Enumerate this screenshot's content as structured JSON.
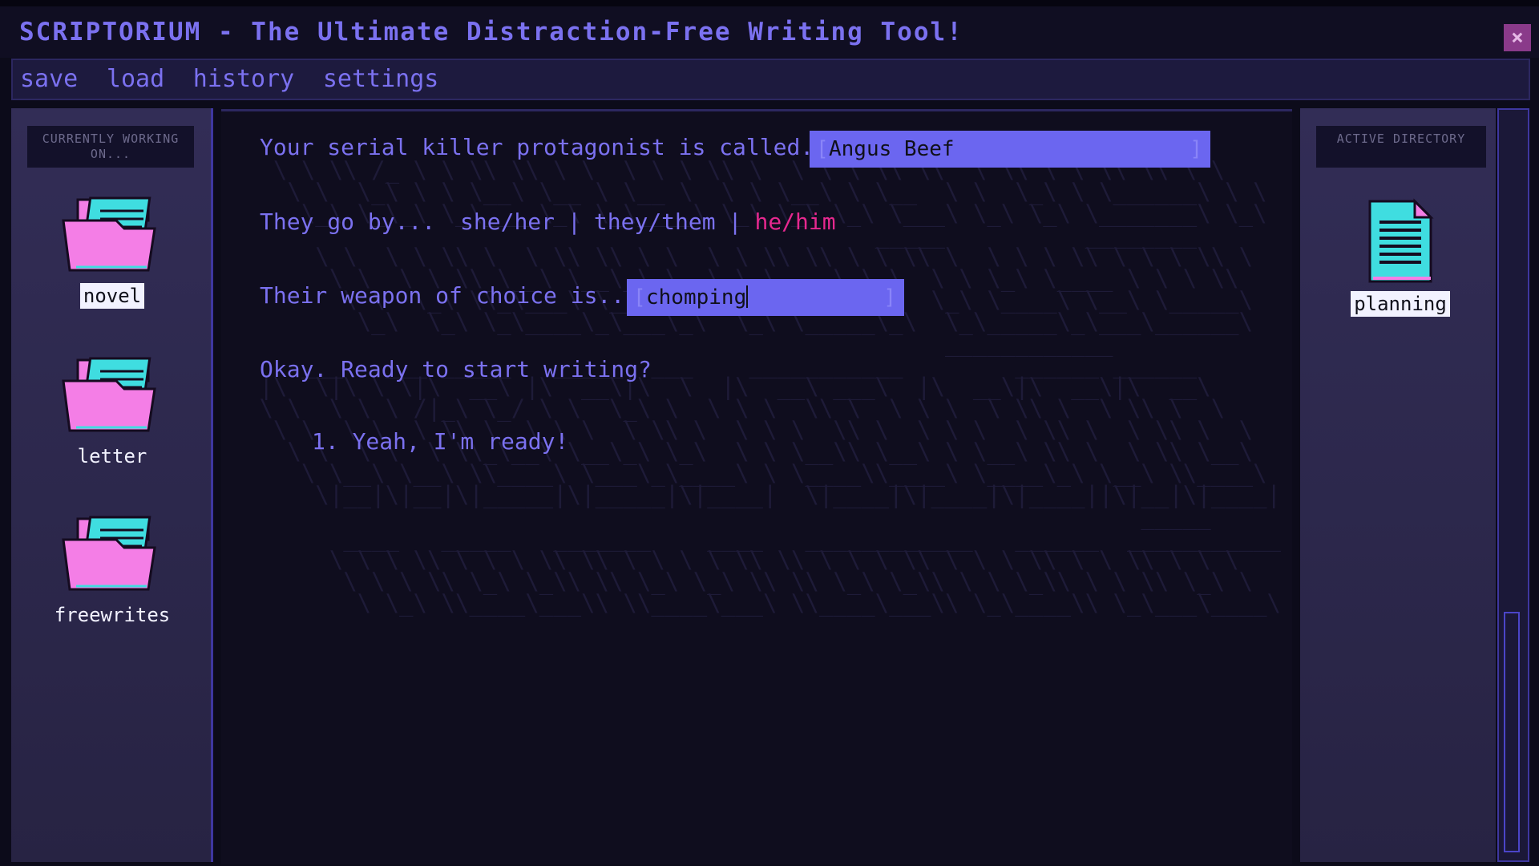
{
  "app": {
    "title": "SCRIPTORIUM - The Ultimate Distraction-Free Writing Tool!",
    "close_glyph": "×"
  },
  "menu": {
    "items": [
      {
        "label": "save"
      },
      {
        "label": "load"
      },
      {
        "label": "history"
      },
      {
        "label": "settings"
      }
    ]
  },
  "left_panel": {
    "header": "CURRENTLY WORKING ON...",
    "folders": [
      {
        "label": "novel",
        "selected": true,
        "icon": "folder-icon"
      },
      {
        "label": "letter",
        "selected": false,
        "icon": "folder-icon"
      },
      {
        "label": "freewrites",
        "selected": false,
        "icon": "folder-icon"
      }
    ]
  },
  "editor": {
    "q1": {
      "prompt": "Your serial killer protagonist is called...",
      "value": "Angus Beef"
    },
    "q2": {
      "prompt": "They go by...",
      "options": [
        "she/her",
        "they/them",
        "he/him"
      ],
      "separator": "|",
      "selected": "he/him"
    },
    "q3": {
      "prompt": "Their weapon of choice is...",
      "value": "chomping"
    },
    "q4": {
      "prompt": "Okay. Ready to start writing?"
    },
    "choices": [
      {
        "label": "1. Yeah, I'm ready!"
      }
    ],
    "field_brackets": {
      "left": "[",
      "right": "]"
    }
  },
  "right_panel": {
    "header": "ACTIVE DIRECTORY",
    "files": [
      {
        "label": "planning",
        "icon": "document-icon"
      }
    ]
  },
  "colors": {
    "accent": "#7b71f0",
    "highlight": "#e6288f",
    "field": "#6b66f0",
    "folder_pink": "#f47ee6",
    "folder_cyan": "#3fdde0"
  }
}
